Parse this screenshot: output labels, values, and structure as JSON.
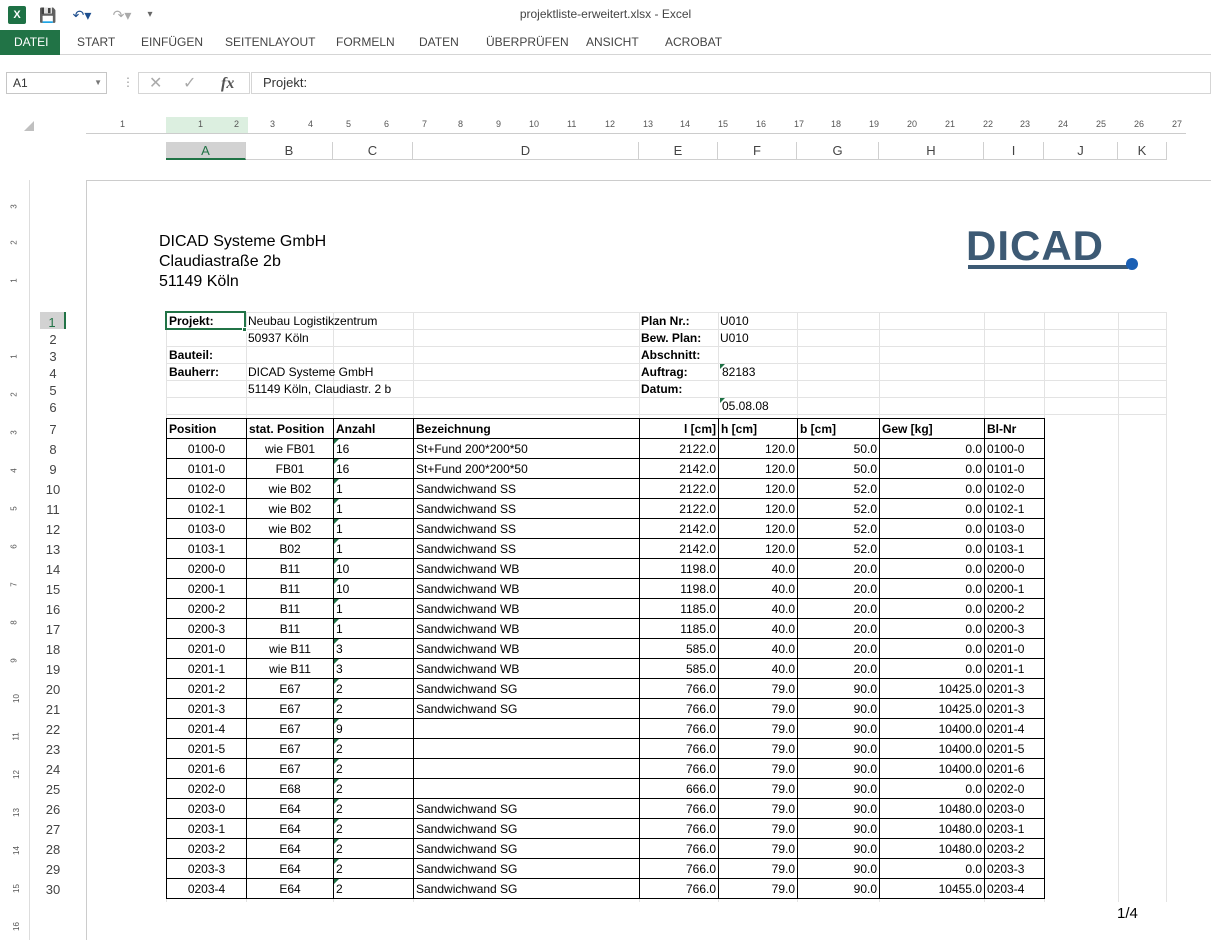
{
  "window": {
    "title": "projektliste-erweitert.xlsx - Excel",
    "icon_label": "X"
  },
  "ribbon": {
    "tabs": [
      "DATEI",
      "START",
      "EINFÜGEN",
      "SEITENLAYOUT",
      "FORMELN",
      "DATEN",
      "ÜBERPRÜFEN",
      "ANSICHT",
      "ACROBAT"
    ]
  },
  "formula_bar": {
    "name_box": "A1",
    "content": "Projekt:",
    "fx": "fx"
  },
  "ruler_numbers": [
    "1",
    "1",
    "2",
    "3",
    "4",
    "5",
    "6",
    "7",
    "8",
    "9",
    "10",
    "11",
    "12",
    "13",
    "14",
    "15",
    "16",
    "17",
    "18",
    "19",
    "20",
    "21",
    "22",
    "23",
    "24",
    "25",
    "26",
    "27"
  ],
  "vruler_numbers": [
    "3",
    "2",
    "1",
    "1",
    "2",
    "3",
    "4",
    "5",
    "6",
    "7",
    "8",
    "9",
    "10",
    "11",
    "12",
    "13",
    "14",
    "15",
    "16"
  ],
  "columns": [
    "A",
    "B",
    "C",
    "D",
    "E",
    "F",
    "G",
    "H",
    "I",
    "J",
    "K"
  ],
  "rows": [
    "1",
    "2",
    "3",
    "4",
    "5",
    "6",
    "7",
    "8",
    "9",
    "10",
    "11",
    "12",
    "13",
    "14",
    "15",
    "16",
    "17",
    "18",
    "19",
    "20",
    "21",
    "22",
    "23",
    "24",
    "25",
    "26",
    "27",
    "28",
    "29",
    "30"
  ],
  "header": {
    "company": "DICAD Systeme GmbH",
    "street": "Claudiastraße 2b",
    "city": "51149 Köln",
    "logo_text": "DICAD",
    "logo_color": "#3d5a74",
    "logo_dot_color": "#1a5fb4"
  },
  "info": {
    "projekt_label": "Projekt:",
    "projekt_1": "Neubau Logistikzentrum",
    "projekt_2": "50937 Köln",
    "bauteil_label": "Bauteil:",
    "bauherr_label": "Bauherr:",
    "bauherr_1": "DICAD Systeme GmbH",
    "bauherr_2": "51149 Köln, Claudiastr. 2 b",
    "plan_label": "Plan Nr.:",
    "plan_value": "U010",
    "bewplan_label": "Bew. Plan:",
    "bewplan_value": "U010",
    "abschnitt_label": "Abschnitt:",
    "auftrag_label": "Auftrag:",
    "auftrag_value": "82183",
    "datum_label": "Datum:",
    "datum_value": "05.08.08"
  },
  "table": {
    "headers": [
      "Position",
      "stat. Position",
      "Anzahl",
      "Bezeichnung",
      "l [cm]",
      "h [cm]",
      "b [cm]",
      "Gew [kg]",
      "Bl-Nr"
    ],
    "rows": [
      [
        "0100-0",
        "wie FB01",
        "16",
        "St+Fund 200*200*50",
        "2122.0",
        "120.0",
        "50.0",
        "0.0",
        "0100-0"
      ],
      [
        "0101-0",
        "FB01",
        "16",
        "St+Fund 200*200*50",
        "2142.0",
        "120.0",
        "50.0",
        "0.0",
        "0101-0"
      ],
      [
        "0102-0",
        "wie B02",
        "1",
        "Sandwichwand SS",
        "2122.0",
        "120.0",
        "52.0",
        "0.0",
        "0102-0"
      ],
      [
        "0102-1",
        "wie B02",
        "1",
        "Sandwichwand SS",
        "2122.0",
        "120.0",
        "52.0",
        "0.0",
        "0102-1"
      ],
      [
        "0103-0",
        "wie B02",
        "1",
        "Sandwichwand SS",
        "2142.0",
        "120.0",
        "52.0",
        "0.0",
        "0103-0"
      ],
      [
        "0103-1",
        "B02",
        "1",
        "Sandwichwand SS",
        "2142.0",
        "120.0",
        "52.0",
        "0.0",
        "0103-1"
      ],
      [
        "0200-0",
        "B11",
        "10",
        "Sandwichwand WB",
        "1198.0",
        "40.0",
        "20.0",
        "0.0",
        "0200-0"
      ],
      [
        "0200-1",
        "B11",
        "10",
        "Sandwichwand WB",
        "1198.0",
        "40.0",
        "20.0",
        "0.0",
        "0200-1"
      ],
      [
        "0200-2",
        "B11",
        "1",
        "Sandwichwand WB",
        "1185.0",
        "40.0",
        "20.0",
        "0.0",
        "0200-2"
      ],
      [
        "0200-3",
        "B11",
        "1",
        "Sandwichwand WB",
        "1185.0",
        "40.0",
        "20.0",
        "0.0",
        "0200-3"
      ],
      [
        "0201-0",
        "wie B11",
        "3",
        "Sandwichwand WB",
        "585.0",
        "40.0",
        "20.0",
        "0.0",
        "0201-0"
      ],
      [
        "0201-1",
        "wie B11",
        "3",
        "Sandwichwand WB",
        "585.0",
        "40.0",
        "20.0",
        "0.0",
        "0201-1"
      ],
      [
        "0201-2",
        "E67",
        "2",
        "Sandwichwand SG",
        "766.0",
        "79.0",
        "90.0",
        "10425.0",
        "0201-3"
      ],
      [
        "0201-3",
        "E67",
        "2",
        "Sandwichwand SG",
        "766.0",
        "79.0",
        "90.0",
        "10425.0",
        "0201-3"
      ],
      [
        "0201-4",
        "E67",
        "9",
        "",
        "766.0",
        "79.0",
        "90.0",
        "10400.0",
        "0201-4"
      ],
      [
        "0201-5",
        "E67",
        "2",
        "",
        "766.0",
        "79.0",
        "90.0",
        "10400.0",
        "0201-5"
      ],
      [
        "0201-6",
        "E67",
        "2",
        "",
        "766.0",
        "79.0",
        "90.0",
        "10400.0",
        "0201-6"
      ],
      [
        "0202-0",
        "E68",
        "2",
        "",
        "666.0",
        "79.0",
        "90.0",
        "0.0",
        "0202-0"
      ],
      [
        "0203-0",
        "E64",
        "2",
        "Sandwichwand SG",
        "766.0",
        "79.0",
        "90.0",
        "10480.0",
        "0203-0"
      ],
      [
        "0203-1",
        "E64",
        "2",
        "Sandwichwand SG",
        "766.0",
        "79.0",
        "90.0",
        "10480.0",
        "0203-1"
      ],
      [
        "0203-2",
        "E64",
        "2",
        "Sandwichwand SG",
        "766.0",
        "79.0",
        "90.0",
        "10480.0",
        "0203-2"
      ],
      [
        "0203-3",
        "E64",
        "2",
        "Sandwichwand SG",
        "766.0",
        "79.0",
        "90.0",
        "0.0",
        "0203-3"
      ],
      [
        "0203-4",
        "E64",
        "2",
        "Sandwichwand SG",
        "766.0",
        "79.0",
        "90.0",
        "10455.0",
        "0203-4"
      ]
    ]
  },
  "page_indicator": "1/4",
  "accent_color": "#217346"
}
